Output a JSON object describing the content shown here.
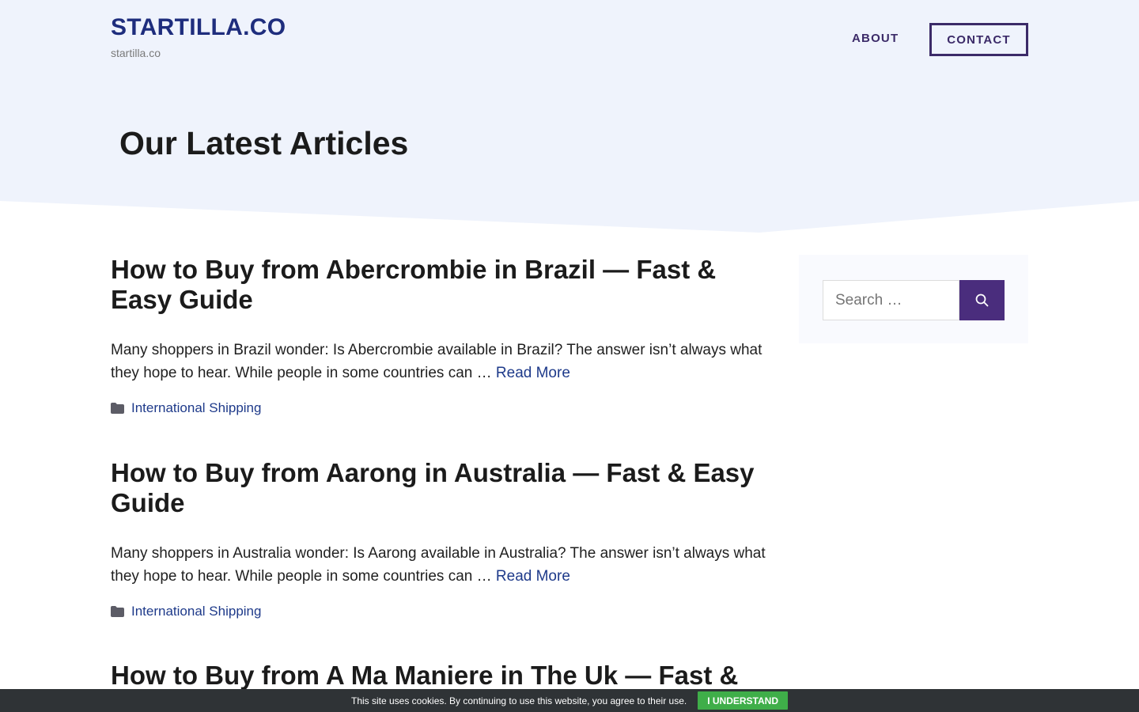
{
  "header": {
    "site_title": "STARTILLA.CO",
    "tagline": "startilla.co",
    "nav": {
      "about": "ABOUT",
      "contact": "CONTACT"
    }
  },
  "hero": {
    "heading": "Our Latest Articles"
  },
  "articles": [
    {
      "title": "How to Buy from Abercrombie in Brazil — Fast & Easy Guide",
      "excerpt": "Many shoppers in Brazil wonder: Is Abercrombie available in Brazil? The answer isn’t always what they hope to hear. While people in some countries can …",
      "read_more": "Read More",
      "category": "International Shipping"
    },
    {
      "title": "How to Buy from Aarong in Australia — Fast & Easy Guide",
      "excerpt": "Many shoppers in Australia wonder: Is Aarong available in Australia? The answer isn’t always what they hope to hear. While people in some countries can …",
      "read_more": "Read More",
      "category": "International Shipping"
    },
    {
      "title": "How to Buy from A Ma Maniere in The Uk — Fast &"
    }
  ],
  "sidebar": {
    "search": {
      "placeholder": "Search …",
      "button_icon": "search-icon"
    }
  },
  "cookie_bar": {
    "message": "This site uses cookies. By continuing to use this website, you agree to their use.",
    "button": "I UNDERSTAND"
  },
  "colors": {
    "hero_background": "#eff3fc",
    "brand": "#1e2d7d",
    "accent": "#4a2d7d",
    "link": "#1e3a8a",
    "cookie_bar": "#2f3336",
    "cookie_button": "#3fae49"
  }
}
